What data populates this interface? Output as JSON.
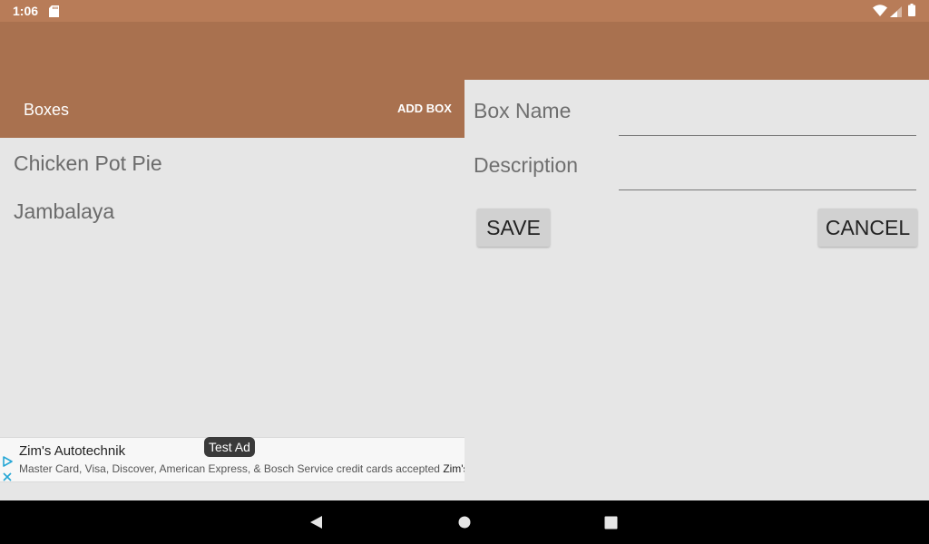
{
  "status_bar": {
    "time": "1:06",
    "icons": [
      "sd-card-icon",
      "wifi-icon",
      "signal-icon",
      "battery-icon"
    ]
  },
  "toolbar": {
    "title": "Boxes",
    "add_box_label": "ADD BOX"
  },
  "boxes": {
    "items": [
      {
        "label": "Chicken Pot Pie"
      },
      {
        "label": "Jambalaya"
      }
    ]
  },
  "ad": {
    "badge": "Test Ad",
    "title": "Zim's Autotechnik",
    "text": "Master Card, Visa, Discover, American Express, & Bosch Service credit cards accepted",
    "text_brand": "Zim's ..."
  },
  "dialog": {
    "name_label": "Box Name",
    "name_value": "",
    "description_label": "Description",
    "description_value": "",
    "save_label": "SAVE",
    "cancel_label": "CANCEL"
  },
  "nav_bar": {
    "icons": [
      "back-icon",
      "home-icon",
      "recents-icon"
    ]
  },
  "colors": {
    "status_bar": "#b87c58",
    "app_bar": "#a9714f",
    "background": "#e6e6e6",
    "button": "#d1d1d1",
    "nav_bar": "#000000"
  }
}
